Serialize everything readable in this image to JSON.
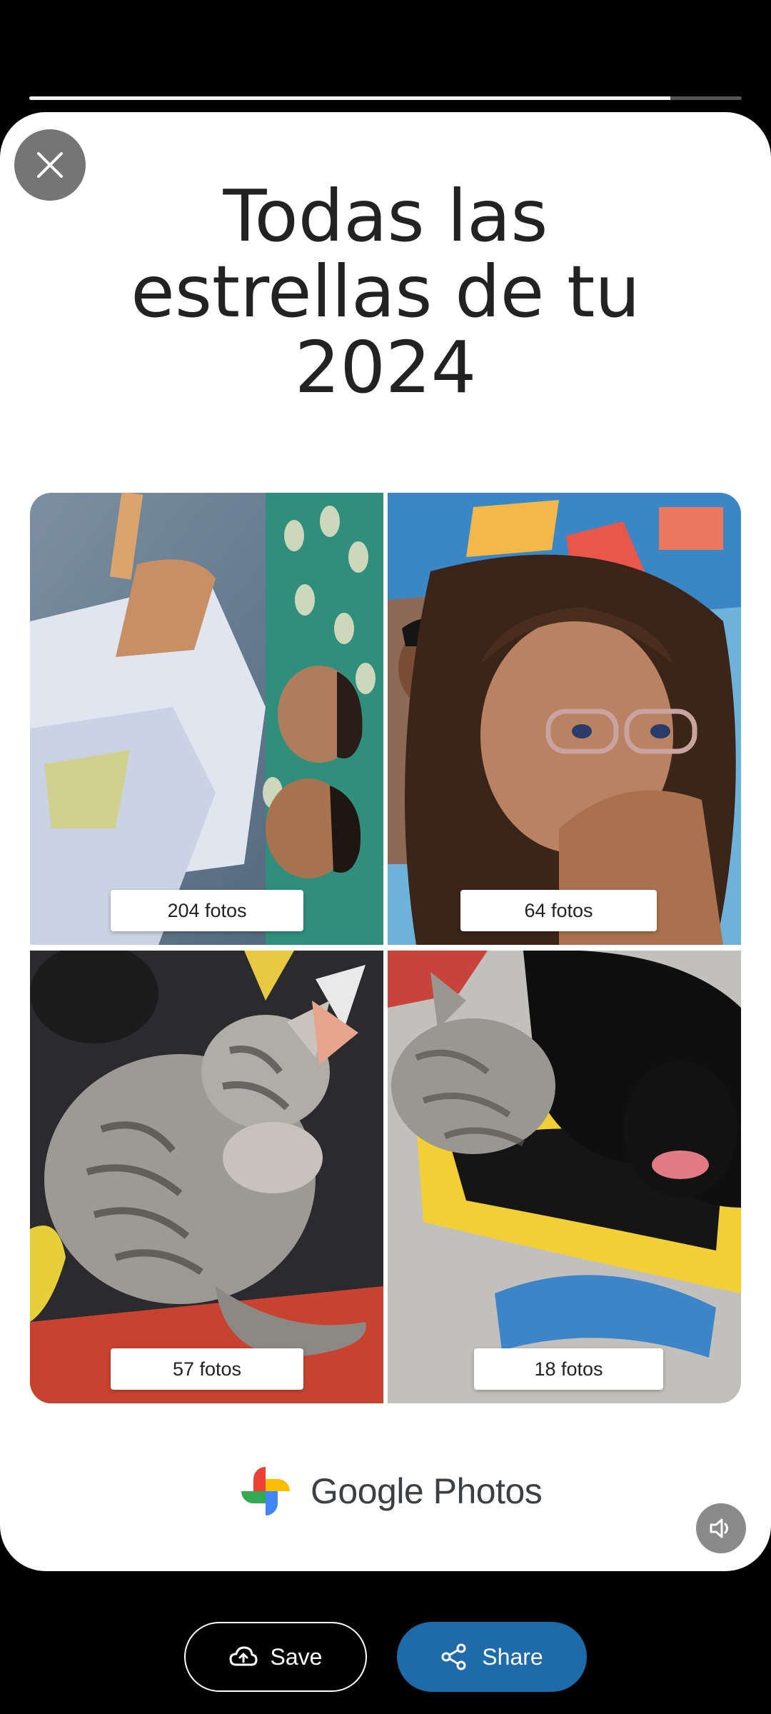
{
  "story": {
    "progress": 0.9,
    "title_lines": [
      "Todas las",
      "estrellas de tu",
      "2024"
    ]
  },
  "tiles": [
    {
      "label": "204 fotos",
      "image_desc": "photo-two-boys-selfie"
    },
    {
      "label": "64 fotos",
      "image_desc": "photo-girl-curly-hair-glasses"
    },
    {
      "label": "57 fotos",
      "image_desc": "photo-tabby-kitten-sleeping"
    },
    {
      "label": "18 fotos",
      "image_desc": "photo-kitten-and-black-dog"
    }
  ],
  "brand": {
    "word1": "Google",
    "word2": "Photos"
  },
  "actions": {
    "save_label": "Save",
    "share_label": "Share"
  },
  "icons": {
    "close": "close-icon",
    "sound": "volume-icon",
    "save": "cloud-upload-icon",
    "share": "share-icon",
    "logo": "pinwheel-logo"
  },
  "colors": {
    "share_button": "#1f6aa8",
    "logo_red": "#ea4335",
    "logo_yellow": "#fbbc04",
    "logo_green": "#34a853",
    "logo_blue": "#4285f4"
  }
}
